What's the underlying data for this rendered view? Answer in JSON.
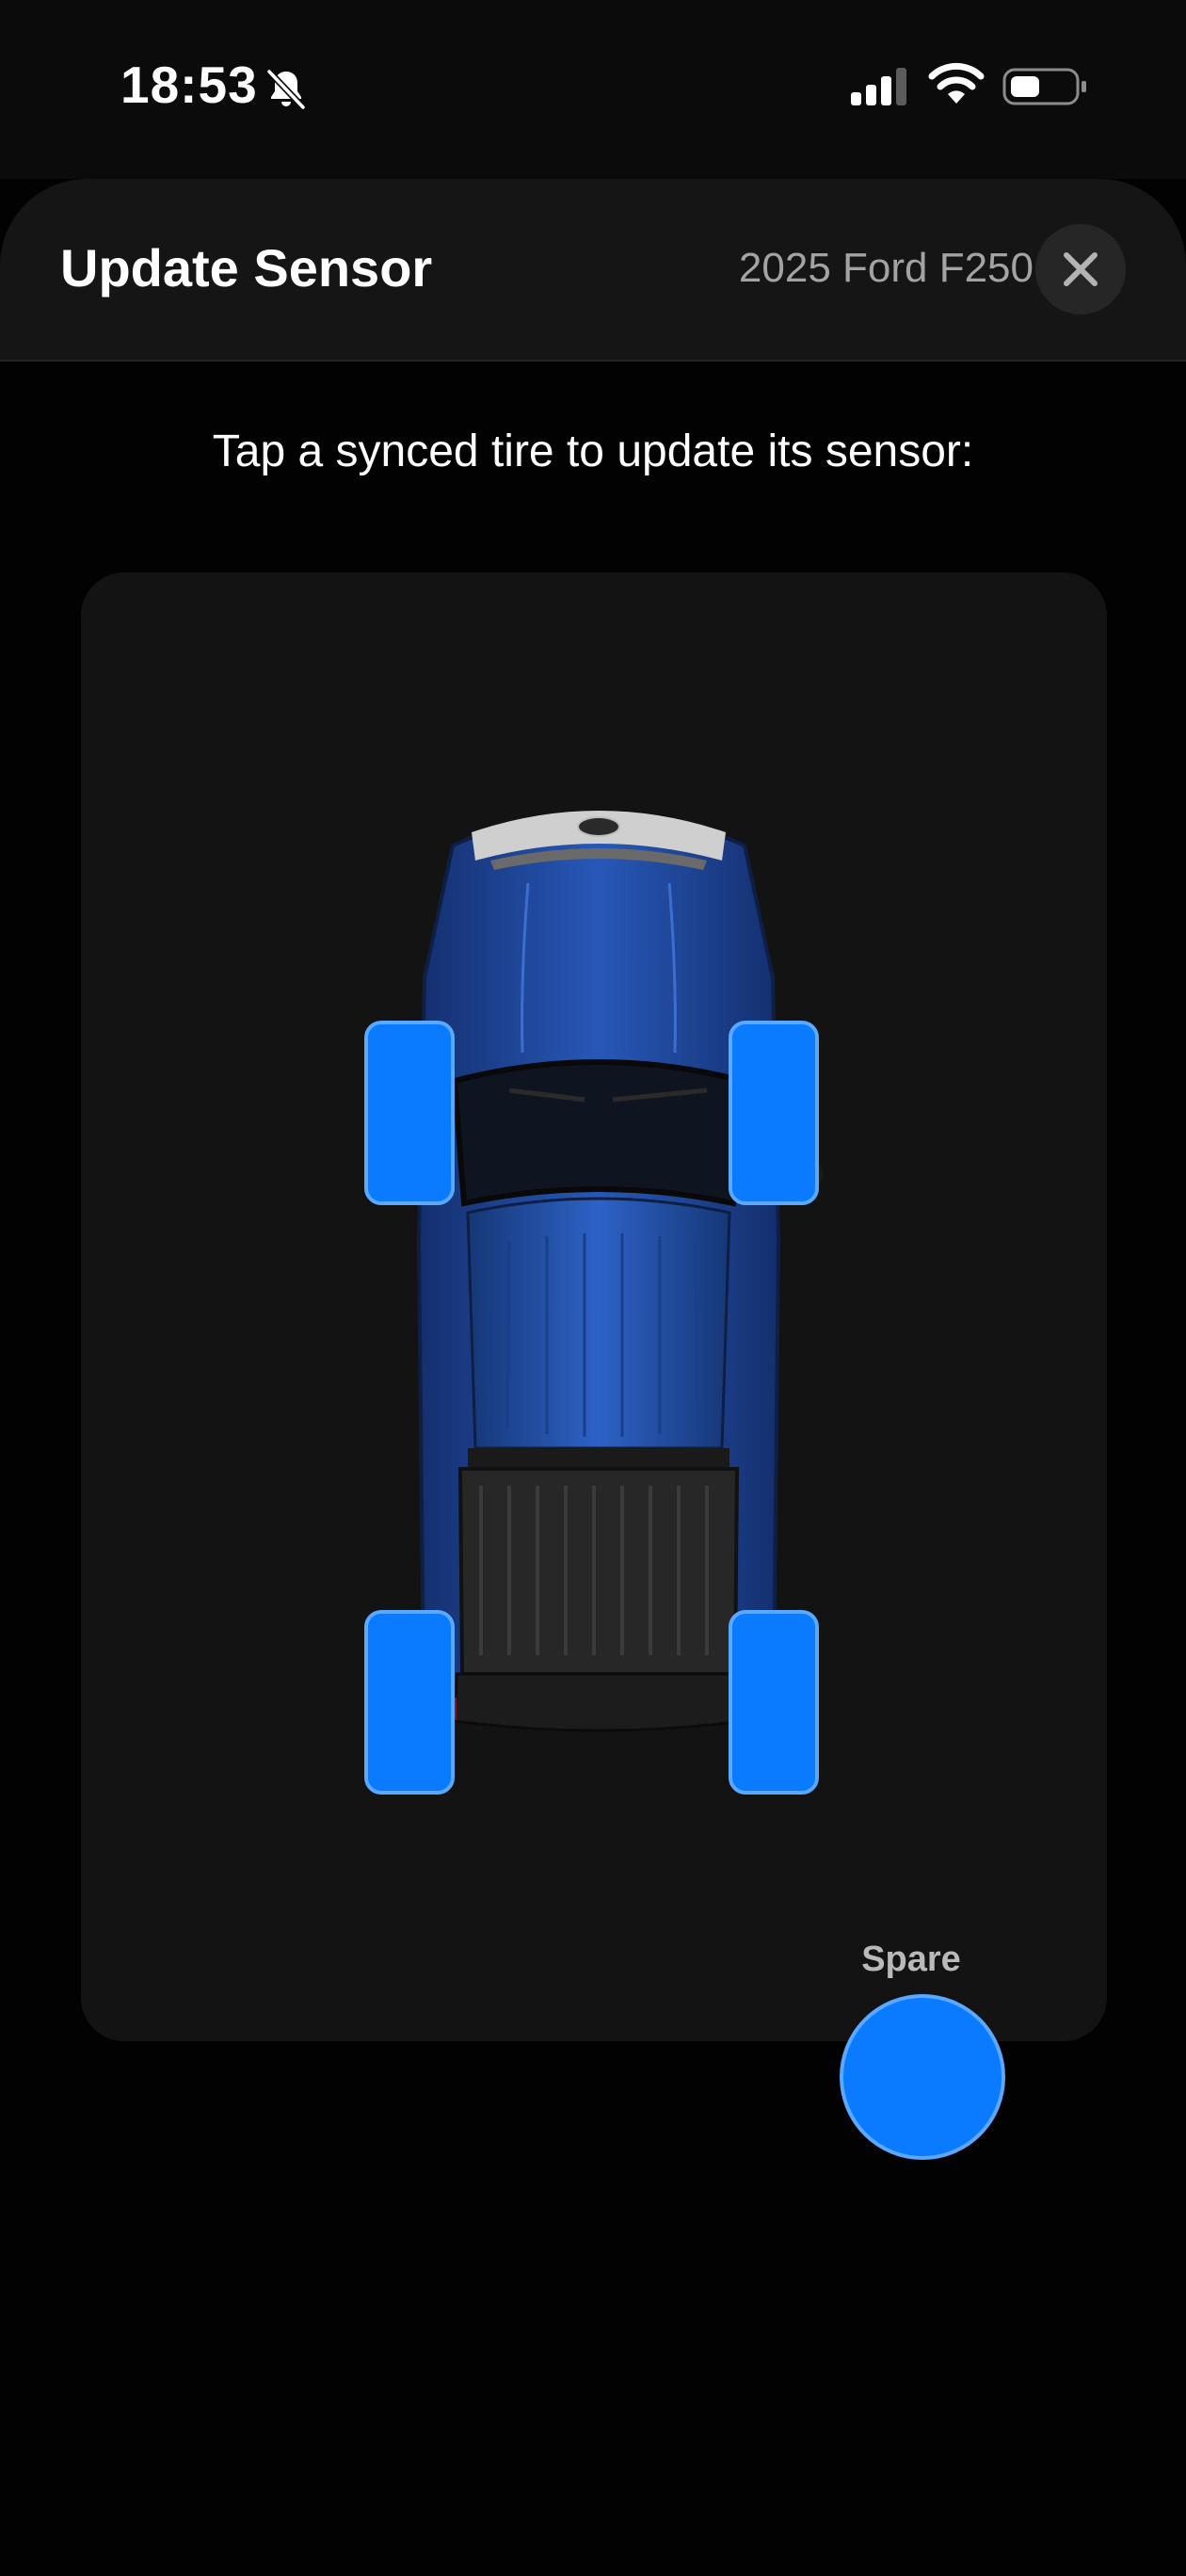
{
  "status_bar": {
    "time": "18:53",
    "icons": [
      "bell-slash-icon",
      "cellular-signal-icon",
      "wifi-icon",
      "battery-icon"
    ]
  },
  "sheet": {
    "title": "Update Sensor",
    "vehicle": "2025 Ford F250",
    "close_icon": "close-icon"
  },
  "instruction": "Tap a synced tire to update its sensor:",
  "diagram": {
    "vehicle_image": "truck-top-view",
    "tires": [
      {
        "position": "front-left",
        "status": "synced"
      },
      {
        "position": "front-right",
        "status": "synced"
      },
      {
        "position": "rear-left",
        "status": "synced"
      },
      {
        "position": "rear-right",
        "status": "synced"
      }
    ],
    "spare": {
      "label": "Spare",
      "status": "synced"
    }
  },
  "colors": {
    "accent": "#0a7aff",
    "card": "#131313",
    "header": "#151515",
    "background": "#000000"
  }
}
